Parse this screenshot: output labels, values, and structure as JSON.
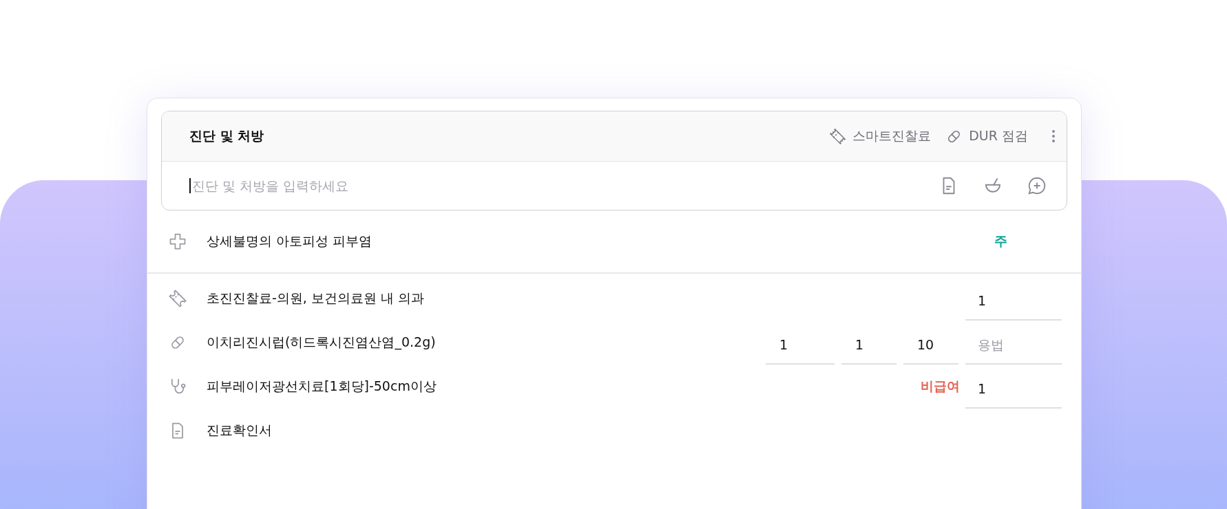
{
  "panel": {
    "title": "진단 및 처방",
    "actions": [
      {
        "kind": "ticket",
        "label": "스마트진찰료"
      },
      {
        "kind": "pill",
        "label": "DUR 점검"
      }
    ],
    "input": {
      "placeholder": "진단 및 처방을 입력하세요"
    },
    "input_tools": [
      {
        "kind": "document"
      },
      {
        "kind": "mortar"
      },
      {
        "kind": "chat-plus"
      }
    ]
  },
  "diagnosis": {
    "name": "상세불명의 아토피성 피부염",
    "badge": "주"
  },
  "orders": [
    {
      "kind": "ticket",
      "name": "초진진찰료-의원, 보건의료원 내 의과",
      "usage": {
        "value": "1"
      }
    },
    {
      "kind": "pill",
      "name": "이치리진시럽(히드록시진염산염_0.2g)",
      "doses": [
        "1",
        "1",
        "10"
      ],
      "usage": {
        "placeholder": "용법"
      }
    },
    {
      "kind": "stethoscope",
      "name": "피부레이저광선치료[1회당]-50cm이상",
      "tag": "비급여",
      "usage": {
        "value": "1"
      }
    },
    {
      "kind": "document",
      "name": "진료확인서"
    }
  ]
}
